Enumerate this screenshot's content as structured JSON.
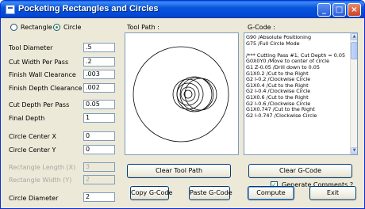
{
  "window": {
    "title": "Pocketing Rectangles and Circles",
    "minimize_glyph": "_",
    "maximize_glyph": "□",
    "close_glyph": "×"
  },
  "mode": {
    "rectangle_label": "Rectangle",
    "circle_label": "Circle",
    "selected": "Circle"
  },
  "params": {
    "tool_diameter": {
      "label": "Tool Diameter",
      "value": ".5"
    },
    "cut_width": {
      "label": "Cut Width Per Pass",
      "value": ".2"
    },
    "finish_wall": {
      "label": "Finish Wall Clearance",
      "value": ".003"
    },
    "finish_depth": {
      "label": "Finish Depth Clearance",
      "value": ".002"
    },
    "cut_depth": {
      "label": "Cut Depth Per Pass",
      "value": "0.05"
    },
    "final_depth": {
      "label": "Final Depth",
      "value": "1"
    },
    "center_x": {
      "label": "Circle Center X",
      "value": "0"
    },
    "center_y": {
      "label": "Circle Center Y",
      "value": "0"
    },
    "rect_length": {
      "label": "Rectangle Length (X)",
      "value": "3"
    },
    "rect_width": {
      "label": "Rectangle Width (Y)",
      "value": "2"
    },
    "circle_diameter": {
      "label": "Circle Diameter",
      "value": "2"
    }
  },
  "toolpath": {
    "label": "Tool Path :",
    "clear_button": "Clear Tool Path"
  },
  "gcode": {
    "label": "G-Code :",
    "lines": [
      "G90  /Absolute Positioning",
      "G75  /Full Circle Mode",
      "",
      "/*** Cutting Pass #1, Cut Depth = 0.05",
      "G0X0Y0  /Move to center of circle",
      "G1 Z-0.05  /Drill down to 0.05",
      "G1X0.2  /Cut to the Right",
      "G2 I-0.2  /Clockwise Circle",
      "G1X0.4  /Cut to the Right",
      "G2 I-0.4  /Clockwise Circle",
      "G1X0.6  /Cut to the Right",
      "G2 I-0.6  /Clockwise Circle",
      "G1X0.747  /Cut to the Right",
      "G2 I-0.747  /Clockwise Circle"
    ],
    "clear_button": "Clear G-Code",
    "comments_label": "Generate Comments ?",
    "comments_checked": true
  },
  "actions": {
    "copy": "Copy G-Code",
    "paste": "Paste G-Code",
    "compute": "Compute",
    "exit": "Exit"
  },
  "colors": {
    "title_bar": "#0a5bdb",
    "window_face": "#ece9d8",
    "border": "#7f9db9"
  }
}
